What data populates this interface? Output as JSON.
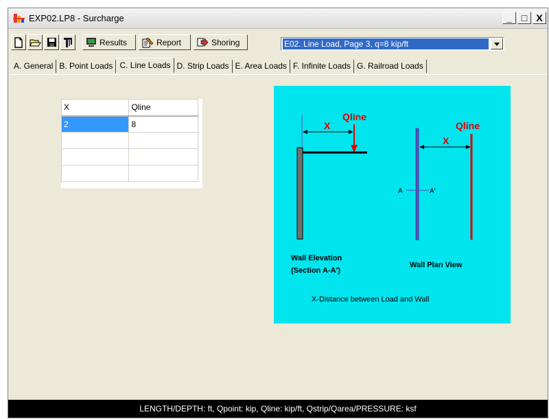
{
  "window": {
    "title": "EXP02.LP8 - Surcharge",
    "controls": {
      "minimize": "_",
      "maximize": "□",
      "close": "X"
    }
  },
  "toolbar": {
    "results_label": "Results",
    "report_label": "Report",
    "shoring_label": "Shoring",
    "example_selected": "E02. Line Load, Page 3, q=8 kip/ft"
  },
  "tabs": [
    {
      "label": "A. General"
    },
    {
      "label": "B. Point Loads"
    },
    {
      "label": "C. Line Loads"
    },
    {
      "label": "D. Strip Loads"
    },
    {
      "label": "E. Area Loads"
    },
    {
      "label": "F. Infinite Loads"
    },
    {
      "label": "G. Railroad Loads"
    }
  ],
  "active_tab": "C. Line Loads",
  "grid": {
    "headers": [
      "X",
      "Qline"
    ],
    "rows": [
      [
        "2",
        "8"
      ],
      [
        "",
        ""
      ],
      [
        "",
        ""
      ],
      [
        "",
        ""
      ]
    ]
  },
  "diagram": {
    "load_label_left": "Qline",
    "distance_label_left": "X",
    "load_label_right": "Qline",
    "distance_label_right": "X",
    "section_a": "A",
    "section_a_prime": "A'",
    "caption_left_line1": "Wall Elevation",
    "caption_left_line2": "(Section A-A')",
    "caption_right": "Wall Plan View",
    "description": "X-Distance between Load and Wall",
    "colors": {
      "background": "#00e5ee",
      "load": "#e00000",
      "wall": "#606060",
      "plan_wall": "#5a50c0"
    }
  },
  "statusbar": {
    "text": "LENGTH/DEPTH: ft, Qpoint: kip, Qline: kip/ft, Qstrip/Qarea/PRESSURE: ksf"
  }
}
